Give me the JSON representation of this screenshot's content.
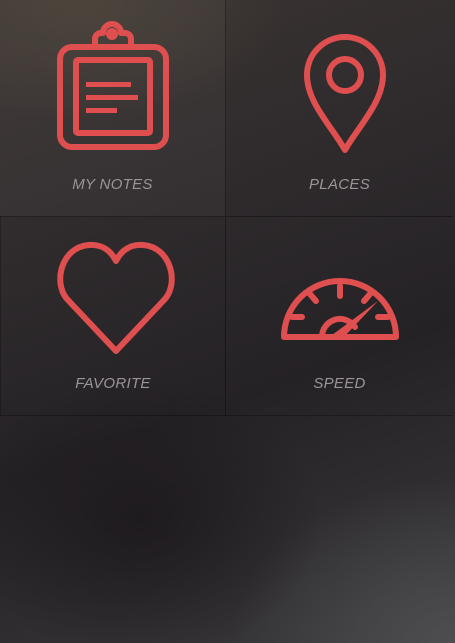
{
  "menu": {
    "items": [
      {
        "label": "MY NOTES",
        "icon": "clipboard-icon"
      },
      {
        "label": "PLACES",
        "icon": "map-pin-icon"
      },
      {
        "label": "FAVORITE",
        "icon": "heart-icon"
      },
      {
        "label": "SPEED",
        "icon": "speedometer-icon"
      }
    ]
  },
  "theme": {
    "accent": "#e04f4f",
    "label_color": "#9b9597",
    "background": "#2b2729"
  }
}
